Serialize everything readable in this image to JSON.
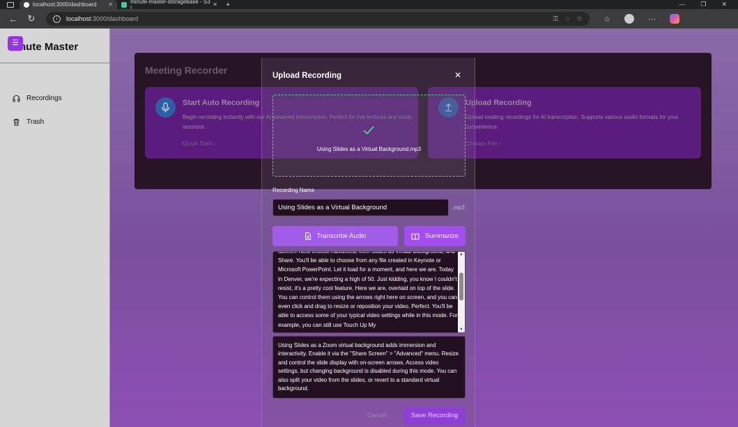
{
  "browser": {
    "tabs": [
      {
        "title": "localhost:3000/dashboard",
        "active": true
      },
      {
        "title": "minute-master-storagebase - S3 |",
        "active": false
      }
    ],
    "url_host": "localhost",
    "url_path": ":3000/dashboard"
  },
  "sidebar": {
    "brand": "nute Master",
    "items": [
      {
        "label": "Recordings",
        "icon": "headphones-icon"
      },
      {
        "label": "Trash",
        "icon": "trash-icon"
      }
    ]
  },
  "dashboard": {
    "title": "Meeting Recorder",
    "cards": [
      {
        "title": "Start Auto Recording",
        "description": "Begin recording instantly with our AI-powered transcription. Perfect for live lectures and study sessions.",
        "link": "Quick Start",
        "icon": "microphone-icon"
      },
      {
        "title": "Upload Recording",
        "description": "Upload existing recordings for AI transcription. Supports various audio formats for your convenience.",
        "link": "Choose File",
        "icon": "upload-icon"
      }
    ]
  },
  "modal": {
    "title": "Upload Recording",
    "file_name": "Using Slides as a Virtual Background.mp3",
    "recording_name_label": "Recording Name",
    "recording_name_value": "Using Slides as a Virtual Background",
    "extension": ".mp3",
    "transcribe_label": "Transcribe Audio",
    "summarize_label": "Summarize",
    "transcript": "Screen. Next choose Advanced, then Slides as Virtual Background, and Share. You'll be able to choose from any file created in Keynote or Microsoft PowerPoint. Let it load for a moment, and here we are. Today in Denver, we're expecting a high of 50. Just kidding, you know I couldn't resist, it's a pretty cool feature. Here we are, overlaid on top of the slide. You can control them using the arrows right here on screen, and you can even click and drag to resize or reposition your video. Perfect. You'll be able to access some of your typical video settings while in this mode. For example, you can still use Touch Up My",
    "summary": "Using Slides as a Zoom virtual background adds immersion and interactivity. Enable it via the \"Share Screen\" > \"Advanced\" menu. Resize and control the slide display with on-screen arrows. Access video settings, but changing background is disabled during this mode. You can also split your video from the slides, or revert to a standard virtual background.",
    "cancel_label": "Cancel",
    "save_label": "Save Recording"
  },
  "colors": {
    "accent": "#a855f7",
    "success": "#4ade80",
    "card": "#5b1c7e"
  }
}
